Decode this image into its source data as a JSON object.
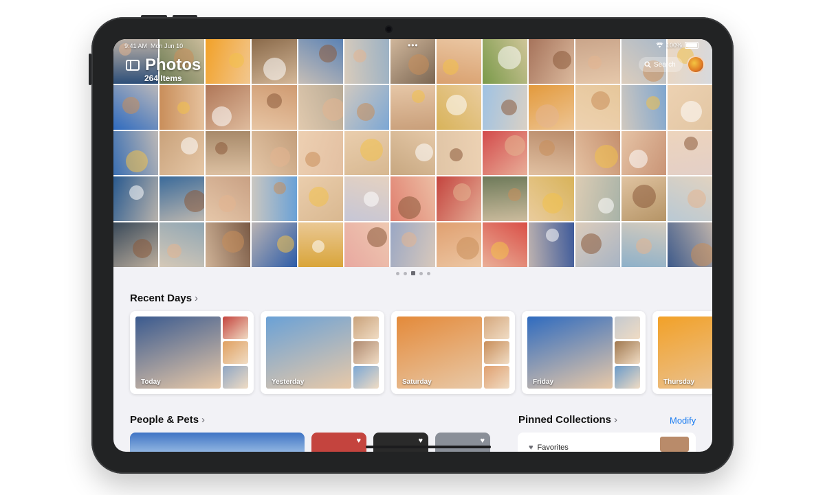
{
  "status_bar": {
    "time": "9:41 AM",
    "date": "Mon Jun 10",
    "top_dots": "•••",
    "battery": "100%"
  },
  "header": {
    "title": "Photos",
    "item_count": "264 Items",
    "search_label": "Search"
  },
  "grid": {
    "columns": 13,
    "rows": 5,
    "tile_colors": [
      [
        "#2e4f79",
        "#6a7a52",
        "#f2a128",
        "#8a6a4a",
        "#5b82b4",
        "#9bb1c4",
        "#7b6652",
        "#d9a06e",
        "#7a9a4a",
        "#a6735b",
        "#caa58a",
        "#a8b8c9",
        "#d7d9dd"
      ],
      [
        "#2f6bbf",
        "#c98e5a",
        "#b07758",
        "#cf9b72",
        "#b8aa95",
        "#7ca7d4",
        "#c99f7a",
        "#d8b35a",
        "#9fc2e3",
        "#e39a3c",
        "#e6c79b",
        "#7fa6cf",
        "#e2c6a3"
      ],
      [
        "#3b6fb2",
        "#c9a27b",
        "#a88a6a",
        "#c39e7b",
        "#e3c0a2",
        "#d7b891",
        "#c7a780",
        "#e0c5a6",
        "#d34b4b",
        "#b98b6a",
        "#c58f6d",
        "#c99476",
        "#e3cfc7"
      ],
      [
        "#2a5a8f",
        "#3a6a9a",
        "#c9a184",
        "#6aa1d6",
        "#d9b890",
        "#c6c6d6",
        "#e08070",
        "#c4443e",
        "#6e7a5a",
        "#d8b35a",
        "#a8b3a8",
        "#b59466",
        "#b9c9d4"
      ],
      [
        "#3a4a5a",
        "#8fa6b4",
        "#7a5a45",
        "#2d5ca8",
        "#d9a53a",
        "#e8a8a0",
        "#9aa7c4",
        "#e0a070",
        "#d94f47",
        "#3e5a9a",
        "#a8b4c4",
        "#8db0c9",
        "#3e5a8a"
      ]
    ]
  },
  "pager": {
    "dot_count": 5,
    "active_index": 2
  },
  "recent_days": {
    "title": "Recent Days",
    "cards": [
      {
        "label": "Today",
        "main_color": "#3a5a8f",
        "side_colors": [
          "#c4443e",
          "#e0a060",
          "#8fa6c4"
        ]
      },
      {
        "label": "Yesterday",
        "main_color": "#6aa1d6",
        "side_colors": [
          "#c9a27b",
          "#b08a70",
          "#7ca7d4"
        ]
      },
      {
        "label": "Saturday",
        "main_color": "#e48a3a",
        "side_colors": [
          "#d5a87e",
          "#c98e5a",
          "#e0a070"
        ]
      },
      {
        "label": "Friday",
        "main_color": "#2f6bbf",
        "side_colors": [
          "#c4c9cf",
          "#a0784f",
          "#6a9ac9"
        ]
      },
      {
        "label": "Thursday",
        "main_color": "#f2a128",
        "side_colors": []
      }
    ]
  },
  "people_pets": {
    "title": "People & Pets",
    "strip_colors": [
      "#4a7bc8",
      "#c4443e",
      "#2a2a2a",
      "#8a8f98"
    ]
  },
  "pinned_collections": {
    "title": "Pinned Collections",
    "modify_label": "Modify",
    "first_item": "Favorites"
  },
  "colors": {
    "accent": "#1a7cf0",
    "background": "#f2f2f6",
    "device": "#222324"
  },
  "icons": {
    "sidebar": "sidebar-toggle-icon",
    "search": "search-icon",
    "favorite": "heart-icon",
    "chevron": "chevron-right-icon"
  }
}
